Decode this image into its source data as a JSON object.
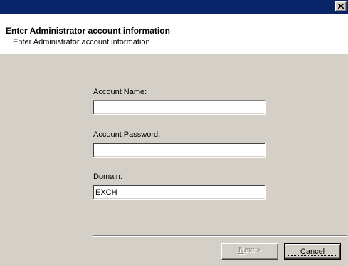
{
  "titlebar": {
    "title": "",
    "close_glyph": "close-icon"
  },
  "header": {
    "title": "Enter Administrator account information",
    "subtitle": "Enter Administrator account information"
  },
  "form": {
    "account_name": {
      "label": "Account Name:",
      "value": ""
    },
    "account_password": {
      "label": "Account Password:",
      "value": ""
    },
    "domain": {
      "label": "Domain:",
      "value": "EXCH"
    }
  },
  "buttons": {
    "next": {
      "label_underlined": "N",
      "label_rest": "ext >",
      "enabled": false
    },
    "cancel": {
      "label_underlined": "C",
      "label_rest": "ancel",
      "enabled": true
    }
  },
  "colors": {
    "titlebar": "#0a246a",
    "face": "#d4d0c8",
    "header_bg": "#ffffff",
    "disabled_text": "#808080"
  }
}
